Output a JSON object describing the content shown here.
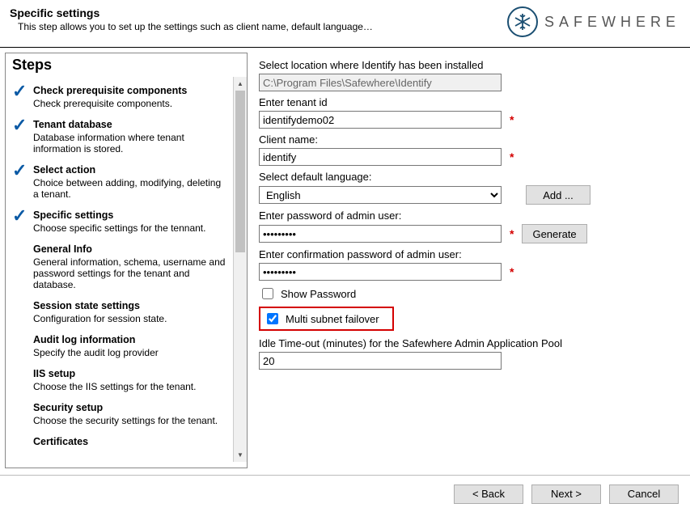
{
  "header": {
    "title": "Specific settings",
    "subtitle": "This step allows you to set up the settings such as client name, default language…",
    "brand": "SAFEWHERE"
  },
  "sidebar": {
    "title": "Steps",
    "items": [
      {
        "title": "Check prerequisite components",
        "desc": "Check prerequisite components.",
        "checked": true
      },
      {
        "title": "Tenant database",
        "desc": "Database information where tenant information is stored.",
        "checked": true
      },
      {
        "title": "Select action",
        "desc": "Choice between adding, modifying, deleting a tenant.",
        "checked": true
      },
      {
        "title": "Specific settings",
        "desc": "Choose specific settings for the tennant.",
        "checked": true
      },
      {
        "title": "General Info",
        "desc": "General information, schema, username and password settings for the tenant and database.",
        "checked": false
      },
      {
        "title": "Session state settings",
        "desc": "Configuration for session state.",
        "checked": false
      },
      {
        "title": "Audit log information",
        "desc": "Specify the audit log provider",
        "checked": false
      },
      {
        "title": "IIS setup",
        "desc": "Choose the IIS settings for the tenant.",
        "checked": false
      },
      {
        "title": "Security setup",
        "desc": "Choose the security settings for the tenant.",
        "checked": false
      },
      {
        "title": "Certificates",
        "desc": "",
        "checked": false
      }
    ]
  },
  "main": {
    "location_label": "Select location where Identify has been installed",
    "location_value": "C:\\Program Files\\Safewhere\\Identify",
    "tenant_label": "Enter tenant id",
    "tenant_value": "identifydemo02",
    "client_label": "Client name:",
    "client_value": "identify",
    "lang_label": "Select default language:",
    "lang_value": "English",
    "add_btn": "Add ...",
    "pwd_label": "Enter password of admin user:",
    "pwd_value": "•••••••••",
    "gen_btn": "Generate",
    "pwd2_label": "Enter confirmation password of admin user:",
    "pwd2_value": "•••••••••",
    "show_pwd": "Show Password",
    "multi_subnet": "Multi subnet failover",
    "idle_label": "Idle Time-out (minutes) for the Safewhere Admin Application Pool",
    "idle_value": "20"
  },
  "footer": {
    "back": "< Back",
    "next": "Next >",
    "cancel": "Cancel"
  }
}
